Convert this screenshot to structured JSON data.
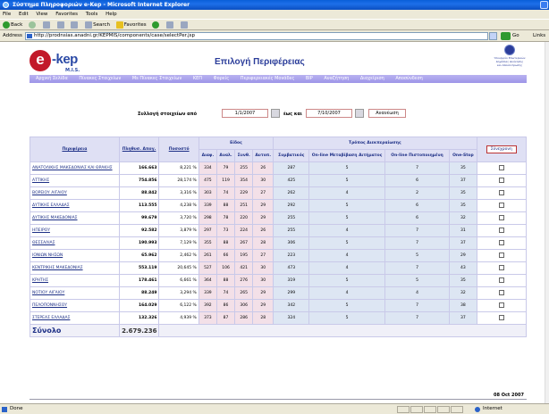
{
  "window": {
    "title": "Σύστημα Πληροφοριών e-Kep - Microsoft Internet Explorer"
  },
  "menu": [
    "File",
    "Edit",
    "View",
    "Favorites",
    "Tools",
    "Help"
  ],
  "toolbar": {
    "back": "Back",
    "search": "Search",
    "favorites": "Favorites"
  },
  "address": {
    "label": "Address",
    "url": "http://prodnsias.anadni.gr/KEPMIS/components/case/selectPer.jsp",
    "go": "Go",
    "links": "Links"
  },
  "logo": {
    "letter": "e",
    "name": "-kep",
    "sub": "M.I.S."
  },
  "page": {
    "title": "Επιλογή Περιφέρειας"
  },
  "emblem": {
    "text": "Υπουργείο Εσωτερικών Δημόσιας Διοίκησης και Αποκέντρωσης"
  },
  "nav": [
    "Αρχική Σελίδα",
    "Πίνακες Στοιχείων",
    "Ms Πίνακες Στοιχείων",
    "ΚΕΠ",
    "Φορείς",
    "Περιφερειακές Μονάδες",
    "ΒΙΡ",
    "Αναζήτηση",
    "Διαχείριση",
    "Αποσύνδεση"
  ],
  "filter": {
    "from_label": "Συλλογή στοιχείων από",
    "from": "1/1/2007",
    "to_label": "έως και",
    "to": "7/10/2007",
    "refresh": "Ανανέωση"
  },
  "table": {
    "headers": {
      "region": "Περιφέρεια",
      "pop": "Πληθυσ. Απογ.",
      "percent": "Ποσοστό",
      "type_group": "Είδος",
      "type_cols": [
        "Διαφ.",
        "Αναλ.",
        "Συνθ.",
        "Αυτοπ."
      ],
      "proc_group": "Τρόπος Διεκπεραίωσης",
      "proc_cols": [
        "Συμβατικός",
        "On-line Μεταβίβαση Αιτήματος",
        "On-line Πιστοποιημένη",
        "One-Stop"
      ],
      "save": "Σύνεχρονη"
    },
    "rows": [
      {
        "region": "ΑΝΑΤΟΛΙΚΗΣ ΜΑΚΕΔΟΝΙΑΣ ΚΑΙ ΘΡΑΚΗΣ",
        "pop": "166.663",
        "percent": "8,221 %",
        "d": "334",
        "a": "79",
        "s": "255",
        "au": "26",
        "conv": "287",
        "ol1": "5",
        "ol2": "7",
        "os": "35"
      },
      {
        "region": "ΑΤΤΙΚΗΣ",
        "pop": "754.856",
        "percent": "28,174 %",
        "d": "475",
        "a": "119",
        "s": "354",
        "au": "30",
        "conv": "425",
        "ol1": "5",
        "ol2": "6",
        "os": "37"
      },
      {
        "region": "ΒΟΡΕΙΟΥ ΑΙΓΑΙΟΥ",
        "pop": "88.842",
        "percent": "3,316 %",
        "d": "303",
        "a": "74",
        "s": "229",
        "au": "27",
        "conv": "262",
        "ol1": "4",
        "ol2": "2",
        "os": "35"
      },
      {
        "region": "ΔΥΤΙΚΗΣ ΕΛΛΑΔΑΣ",
        "pop": "113.555",
        "percent": "4,238 %",
        "d": "339",
        "a": "88",
        "s": "251",
        "au": "29",
        "conv": "292",
        "ol1": "5",
        "ol2": "6",
        "os": "35"
      },
      {
        "region": "ΔΥΤΙΚΗΣ ΜΑΚΕΔΟΝΙΑΣ",
        "pop": "99.679",
        "percent": "3,720 %",
        "d": "298",
        "a": "78",
        "s": "220",
        "au": "29",
        "conv": "255",
        "ol1": "5",
        "ol2": "6",
        "os": "32"
      },
      {
        "region": "ΗΠΕΙΡΟΥ",
        "pop": "92.582",
        "percent": "3,879 %",
        "d": "297",
        "a": "73",
        "s": "224",
        "au": "26",
        "conv": "255",
        "ol1": "4",
        "ol2": "7",
        "os": "31"
      },
      {
        "region": "ΘΕΣΣΑΛΙΑΣ",
        "pop": "190.993",
        "percent": "7,129 %",
        "d": "355",
        "a": "88",
        "s": "267",
        "au": "28",
        "conv": "306",
        "ol1": "5",
        "ol2": "7",
        "os": "37"
      },
      {
        "region": "ΙΟΝΙΩΝ ΝΗΣΩΝ",
        "pop": "65.962",
        "percent": "2,462 %",
        "d": "261",
        "a": "66",
        "s": "195",
        "au": "27",
        "conv": "223",
        "ol1": "4",
        "ol2": "5",
        "os": "29"
      },
      {
        "region": "ΚΕΝΤΡΙΚΗΣ ΜΑΚΕΔΟΝΙΑΣ",
        "pop": "553.119",
        "percent": "20,645 %",
        "d": "527",
        "a": "106",
        "s": "421",
        "au": "30",
        "conv": "473",
        "ol1": "4",
        "ol2": "7",
        "os": "43"
      },
      {
        "region": "ΚΡΗΤΗΣ",
        "pop": "178.461",
        "percent": "6,661 %",
        "d": "364",
        "a": "88",
        "s": "276",
        "au": "30",
        "conv": "319",
        "ol1": "5",
        "ol2": "5",
        "os": "35"
      },
      {
        "region": "ΝΟΤΙΟΥ ΑΙΓΑΙΟΥ",
        "pop": "88.249",
        "percent": "3,294 %",
        "d": "339",
        "a": "74",
        "s": "265",
        "au": "29",
        "conv": "299",
        "ol1": "4",
        "ol2": "4",
        "os": "32"
      },
      {
        "region": "ΠΕΛΟΠΟΝΝΗΣΟΥ",
        "pop": "164.029",
        "percent": "6,122 %",
        "d": "392",
        "a": "86",
        "s": "306",
        "au": "29",
        "conv": "342",
        "ol1": "5",
        "ol2": "7",
        "os": "38"
      },
      {
        "region": "ΣΤΕΡΕΑΣ ΕΛΛΑΔΑΣ",
        "pop": "132.326",
        "percent": "4,939 %",
        "d": "373",
        "a": "87",
        "s": "286",
        "au": "28",
        "conv": "324",
        "ol1": "5",
        "ol2": "7",
        "os": "37"
      }
    ],
    "total": {
      "label": "Σύνολο",
      "pop": "2.679.236"
    }
  },
  "footer": {
    "date": "08 Oct 2007"
  },
  "status": {
    "left": "Done",
    "zone": "Internet"
  }
}
